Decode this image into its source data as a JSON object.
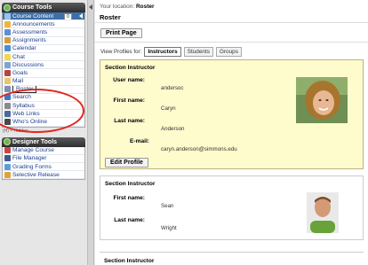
{
  "sidebar": {
    "course_tools_title": "Course Tools",
    "course_content": {
      "label": "Course Content",
      "badge": "0"
    },
    "items": [
      {
        "label": "Announcements",
        "icon": "announcements-icon",
        "color": "#f0b43c"
      },
      {
        "label": "Assessments",
        "icon": "assessments-icon",
        "color": "#5b8fd6"
      },
      {
        "label": "Assignments",
        "icon": "assignments-icon",
        "color": "#d69c3a"
      },
      {
        "label": "Calendar",
        "icon": "calendar-icon",
        "color": "#4f8ccf"
      },
      {
        "label": "Chat",
        "icon": "chat-icon",
        "color": "#f5d54a"
      },
      {
        "label": "Discussions",
        "icon": "discussions-icon",
        "color": "#7fa3cf"
      },
      {
        "label": "Goals",
        "icon": "goals-icon",
        "color": "#b44444"
      },
      {
        "label": "Mail",
        "icon": "mail-icon",
        "color": "#e8c769"
      },
      {
        "label": "Roster",
        "icon": "roster-icon",
        "color": "#7b8fb8",
        "selected": true
      },
      {
        "label": "Search",
        "icon": "search-icon",
        "color": "#3a78c8"
      },
      {
        "label": "Syllabus",
        "icon": "syllabus-icon",
        "color": "#8a8a8a"
      },
      {
        "label": "Web Links",
        "icon": "web-links-icon",
        "color": "#4a6aa0"
      },
      {
        "label": "Who's Online",
        "icon": "whos-online-icon",
        "color": "#4a4a4a"
      }
    ],
    "hidden_note": "(H) = Hidden",
    "designer_tools_title": "Designer Tools",
    "designer_items": [
      {
        "label": "Manage Course",
        "icon": "manage-course-icon",
        "color": "#c94646"
      },
      {
        "label": "File Manager",
        "icon": "file-manager-icon",
        "color": "#3b5b8a"
      },
      {
        "label": "Grading Forms",
        "icon": "grading-forms-icon",
        "color": "#5aa0d8"
      },
      {
        "label": "Selective Release",
        "icon": "selective-release-icon",
        "color": "#e0a23a"
      }
    ]
  },
  "main": {
    "location_prefix": "Your location:",
    "location": "Roster",
    "page_title": "Roster",
    "print_button": "Print Page",
    "view_label": "View Profiles for:",
    "tabs": [
      "Instructors",
      "Students",
      "Groups"
    ],
    "active_tab": "Instructors",
    "instructors": [
      {
        "section_title": "Section Instructor",
        "user_name_label": "User name:",
        "user_name": "andersoc",
        "first_name_label": "First name:",
        "first_name": "Caryn",
        "last_name_label": "Last name:",
        "last_name": "Anderson",
        "email_label": "E-mail:",
        "email": "caryn.anderson@simmons.edu",
        "edit_button": "Edit Profile"
      },
      {
        "section_title": "Section Instructor",
        "first_name_label": "First name:",
        "first_name": "Sean",
        "last_name_label": "Last name:",
        "last_name": "Wright"
      },
      {
        "section_title": "Section Instructor"
      }
    ]
  },
  "colors": {
    "highlight_card": "#fefbcd",
    "nav_link": "#1d3d8f",
    "annotation": "#e0271e",
    "active_nav": "#3e6fa8"
  }
}
